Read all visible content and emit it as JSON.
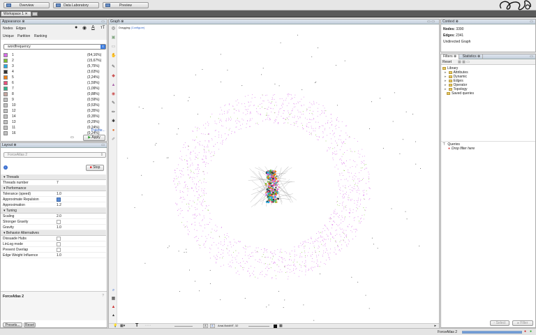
{
  "top_tabs": [
    {
      "label": "Overview",
      "name": "overview-tab"
    },
    {
      "label": "Data Laboratory",
      "name": "data-laboratory-tab"
    },
    {
      "label": "Preview",
      "name": "preview-tab"
    }
  ],
  "workspace": {
    "tab_label": "Workspace 1"
  },
  "appearance": {
    "title": "Appearance",
    "tabs_row1": [
      "Nodes",
      "Edges"
    ],
    "tabs_row2": [
      "Unique",
      "Partition",
      "Ranking"
    ],
    "select_value": "wordfrequency",
    "partitions": [
      {
        "label": "1",
        "pct": "(64,16%)",
        "color": "#d86be8"
      },
      {
        "label": "2",
        "pct": "(15,67%)",
        "color": "#7dbf30"
      },
      {
        "label": "3",
        "pct": "(5,75%)",
        "color": "#2aa9e0"
      },
      {
        "label": "4",
        "pct": "(3,63%)",
        "color": "#333333"
      },
      {
        "label": "5",
        "pct": "(2,24%)",
        "color": "#f07f14"
      },
      {
        "label": "6",
        "pct": "(1,59%)",
        "color": "#e8507a"
      },
      {
        "label": "7",
        "pct": "(1,09%)",
        "color": "#2cb489"
      },
      {
        "label": "8",
        "pct": "(0,88%)",
        "color": "#c8a8a0"
      },
      {
        "label": "9",
        "pct": "(0,59%)",
        "color": "#c0c0c0"
      },
      {
        "label": "10",
        "pct": "(0,53%)",
        "color": "#c0c0c0"
      },
      {
        "label": "12",
        "pct": "(0,35%)",
        "color": "#c0c0c0"
      },
      {
        "label": "14",
        "pct": "(0,35%)",
        "color": "#c0c0c0"
      },
      {
        "label": "13",
        "pct": "(0,29%)",
        "color": "#c0c0c0"
      },
      {
        "label": "11",
        "pct": "(0,24%)",
        "color": "#c0c0c0"
      },
      {
        "label": "16",
        "pct": "(0,24%)",
        "color": "#c0c0c0"
      }
    ],
    "palette_label": "Palette...",
    "apply_label": "Apply"
  },
  "layout": {
    "title": "Layout",
    "algorithm": "ForceAtlas 2",
    "stop_label": "Stop",
    "sections": [
      {
        "title": "Threads",
        "props": [
          {
            "k": "Threads number",
            "v": "7"
          }
        ]
      },
      {
        "title": "Performance",
        "props": [
          {
            "k": "Tolerance (speed)",
            "v": "1.0"
          },
          {
            "k": "Approximate Repulsion",
            "check": true
          },
          {
            "k": "Approximation",
            "v": "1.2"
          }
        ]
      },
      {
        "title": "Tuning",
        "props": [
          {
            "k": "Scaling",
            "v": "2.0"
          },
          {
            "k": "Stronger Gravity",
            "check": false
          },
          {
            "k": "Gravity",
            "v": "1.0"
          }
        ]
      },
      {
        "title": "Behavior Alternatives",
        "props": [
          {
            "k": "Dissuade Hubs",
            "check": false
          },
          {
            "k": "LinLog mode",
            "check": false
          },
          {
            "k": "Prevent Overlap",
            "check": false
          },
          {
            "k": "Edge Weight Influence",
            "v": "1.0"
          }
        ]
      }
    ],
    "desc_title": "ForceAtlas 2",
    "presets_label": "Presets...",
    "reset_label": "Reset"
  },
  "graph": {
    "title": "Graph",
    "mode_label": "Dragging",
    "configure_label": "(Configure)",
    "font_label": "Arial-BoldMT, 32"
  },
  "context": {
    "title": "Context",
    "nodes_label": "Nodes:",
    "nodes_value": "3390",
    "edges_label": "Edges:",
    "edges_value": "2341",
    "graph_type": "Undirected Graph"
  },
  "filters": {
    "tab_filters": "Filters",
    "tab_statistics": "Statistics",
    "reset_label": "Reset",
    "library_label": "Library",
    "items": [
      "Attributes",
      "Dynamic",
      "Edges",
      "Operator",
      "Topology",
      "Saved queries"
    ],
    "queries_label": "Queries",
    "drop_label": "Drop filter here",
    "select_label": "Select",
    "filter_label": "Filter"
  },
  "status": {
    "algorithm": "ForceAtlas 2"
  }
}
